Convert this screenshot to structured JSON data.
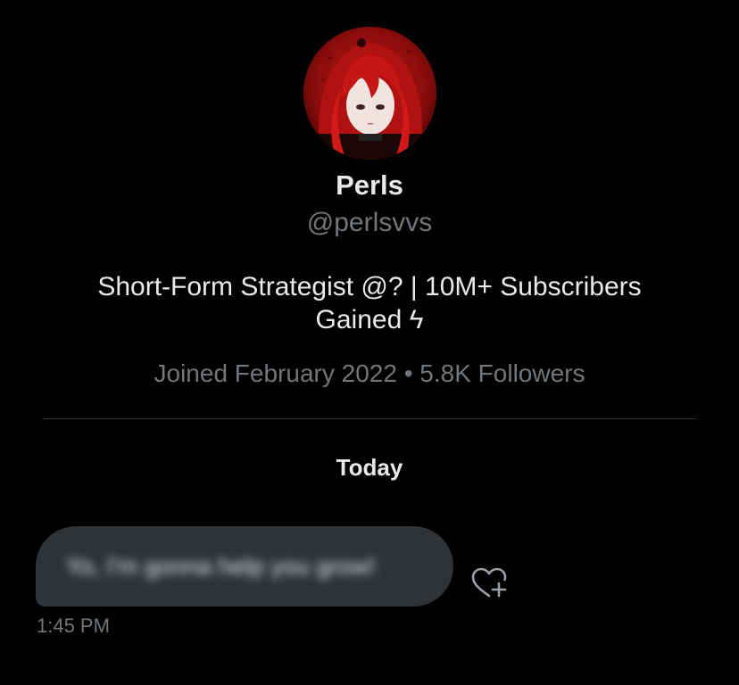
{
  "profile": {
    "name": "Perls",
    "handle": "@perlsvvs",
    "bio": "Short-Form Strategist @? | 10M+ Subscribers Gained ϟ",
    "joined": "Joined February 2022",
    "separator": "•",
    "followers": "5.8K Followers"
  },
  "conversation": {
    "date_label": "Today",
    "messages": [
      {
        "text": "Yo, I'm gonna help you grow!",
        "time": "1:45 PM"
      }
    ]
  },
  "icons": {
    "avatar": "anime-avatar-red-hair",
    "react": "heart-plus-icon"
  },
  "colors": {
    "background": "#000000",
    "primary_text": "#e7e9ea",
    "secondary_text": "#71767b",
    "bubble": "#2f3336",
    "divider": "#2f3336"
  }
}
